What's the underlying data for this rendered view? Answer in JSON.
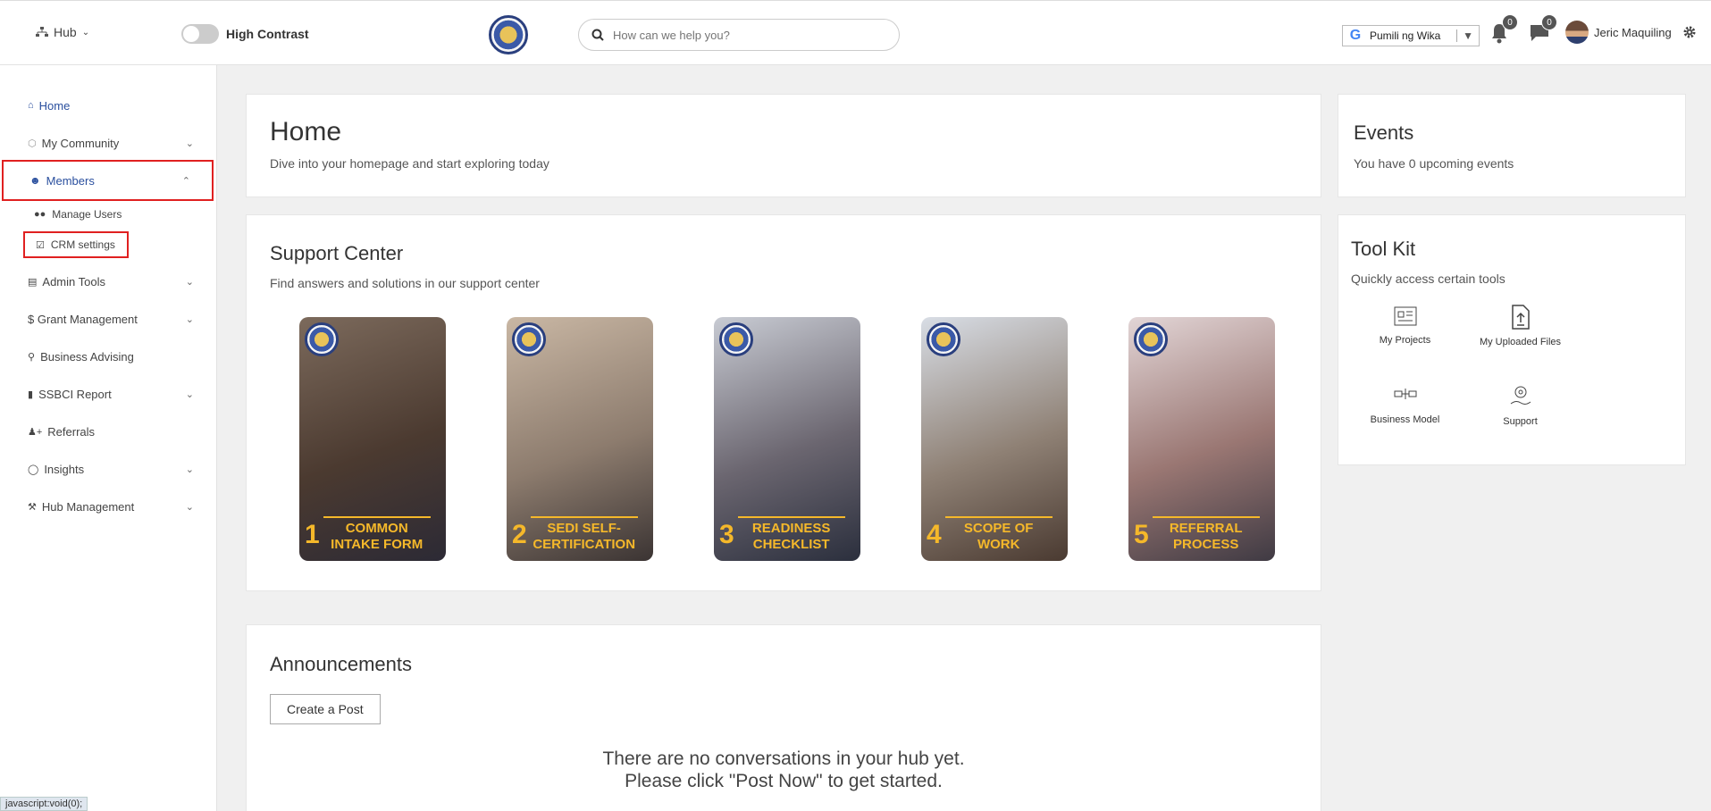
{
  "header": {
    "hub_label": "Hub",
    "contrast_label": "High Contrast",
    "search_placeholder": "How can we help you?",
    "language_label": "Pumili ng Wika",
    "notifications_count": "0",
    "messages_count": "0",
    "user_name": "Jeric Maquiling"
  },
  "sidebar": {
    "items": [
      {
        "label": "Home"
      },
      {
        "label": "My Community"
      },
      {
        "label": "Members"
      },
      {
        "label": "Admin Tools"
      },
      {
        "label": "$ Grant Management"
      },
      {
        "label": "Business Advising"
      },
      {
        "label": "SSBCI Report"
      },
      {
        "label": "Referrals"
      },
      {
        "label": "Insights"
      },
      {
        "label": "Hub Management"
      }
    ],
    "sub_items": [
      {
        "label": "Manage Users"
      },
      {
        "label": "CRM settings"
      }
    ],
    "status_url": "javascript:void(0);"
  },
  "home_card": {
    "title": "Home",
    "subtitle": "Dive into your homepage and start exploring today"
  },
  "support_center": {
    "title": "Support Center",
    "subtitle": "Find answers and solutions in our support center",
    "tiles": [
      {
        "num": "1",
        "text": "COMMON INTAKE FORM"
      },
      {
        "num": "2",
        "text": "SEDI SELF-CERTIFICATION"
      },
      {
        "num": "3",
        "text": "READINESS CHECKLIST"
      },
      {
        "num": "4",
        "text": "SCOPE OF WORK"
      },
      {
        "num": "5",
        "text": "REFERRAL PROCESS"
      }
    ]
  },
  "events": {
    "title": "Events",
    "subtitle": "You have 0 upcoming events"
  },
  "toolkit": {
    "title": "Tool Kit",
    "subtitle": "Quickly access certain tools",
    "tools": [
      {
        "label": "My Projects"
      },
      {
        "label": "My Uploaded Files"
      },
      {
        "label": "Business Model"
      },
      {
        "label": "Support"
      }
    ]
  },
  "announcements": {
    "title": "Announcements",
    "button_label": "Create a Post",
    "empty_line1": "There are no conversations in your hub yet.",
    "empty_line2": "Please click \"Post Now\" to get started."
  }
}
